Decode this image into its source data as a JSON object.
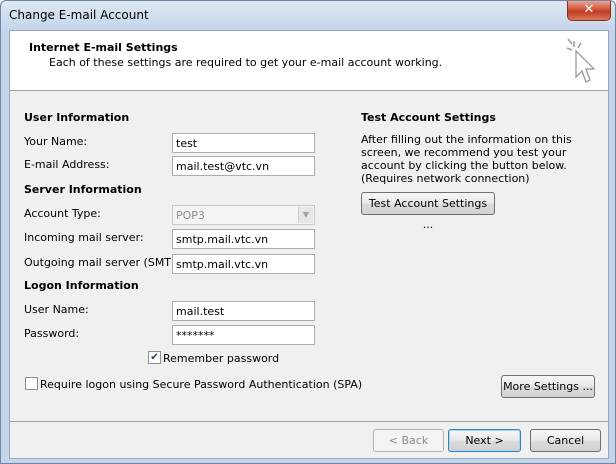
{
  "window": {
    "title": "Change E-mail Account",
    "close_glyph": "✕"
  },
  "header": {
    "title": "Internet E-mail Settings",
    "subtitle": "Each of these settings are required to get your e-mail account working."
  },
  "user_info": {
    "section": "User Information",
    "your_name_label": "Your Name:",
    "your_name_value": "test",
    "email_label": "E-mail Address:",
    "email_value": "mail.test@vtc.vn"
  },
  "server_info": {
    "section": "Server Information",
    "account_type_label": "Account Type:",
    "account_type_value": "POP3",
    "incoming_label": "Incoming mail server:",
    "incoming_value": "smtp.mail.vtc.vn",
    "outgoing_label": "Outgoing mail server (SMTP):",
    "outgoing_value": "smtp.mail.vtc.vn"
  },
  "logon_info": {
    "section": "Logon Information",
    "username_label": "User Name:",
    "username_value": "mail.test",
    "password_label": "Password:",
    "password_value": "*******",
    "remember_label": "Remember password",
    "remember_checked": true,
    "spa_label": "Require logon using Secure Password Authentication (SPA)",
    "spa_checked": false
  },
  "test_settings": {
    "section": "Test Account Settings",
    "description": "After filling out the information on this screen, we recommend you test your account by clicking the button below. (Requires network connection)",
    "button": "Test Account Settings ..."
  },
  "more_settings_button": "More Settings ...",
  "footer": {
    "back": "< Back",
    "next": "Next >",
    "cancel": "Cancel"
  }
}
